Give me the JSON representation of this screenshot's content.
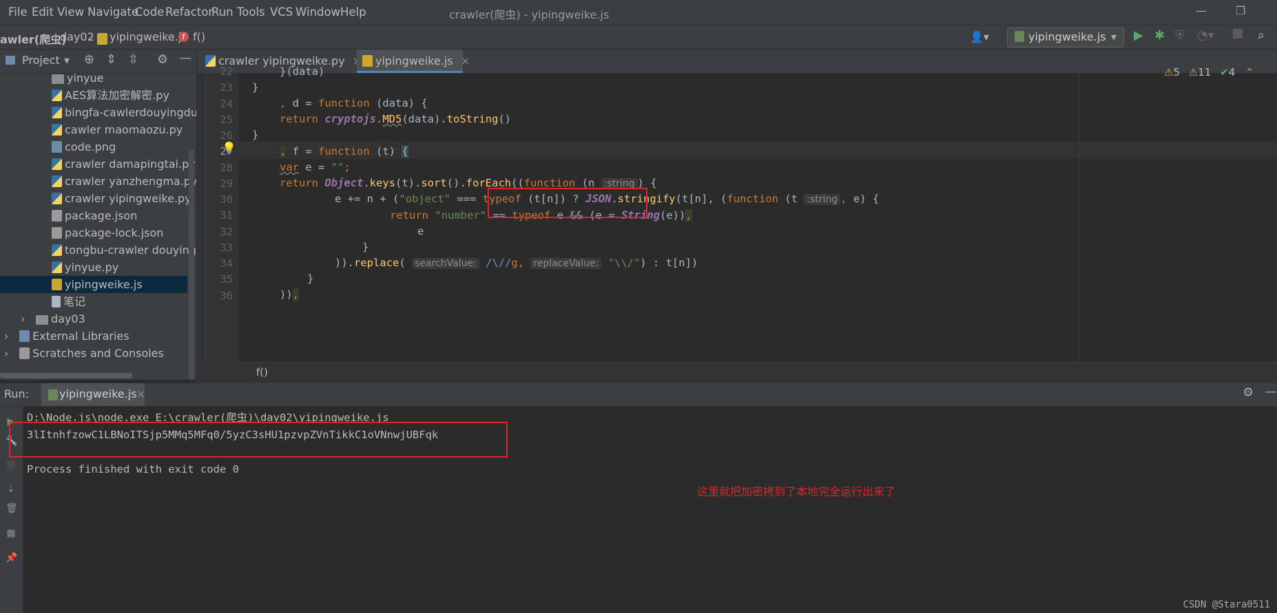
{
  "menu": [
    "File",
    "Edit",
    "View",
    "Navigate",
    "Code",
    "Refactor",
    "Run",
    "Tools",
    "VCS",
    "Window",
    "Help"
  ],
  "window_title": "crawler(爬虫) - yipingweike.js",
  "breadcrumb": {
    "root": "awler(爬虫)",
    "folder": "day02",
    "file": "yipingweike.js",
    "func": "f()"
  },
  "run_config": "yipingweike.js",
  "project_panel": {
    "title": "Project"
  },
  "tree": [
    {
      "label": "yinyue",
      "icon": "folder",
      "indent": 1
    },
    {
      "label": "AES算法加密解密.py",
      "icon": "py",
      "indent": 1
    },
    {
      "label": "bingfa-cawlerdouyingduan",
      "icon": "py",
      "indent": 1
    },
    {
      "label": "cawler maomaozu.py",
      "icon": "py",
      "indent": 1
    },
    {
      "label": "code.png",
      "icon": "png",
      "indent": 1
    },
    {
      "label": "crawler damapingtai.py",
      "icon": "py",
      "indent": 1
    },
    {
      "label": "crawler yanzhengma.py",
      "icon": "py",
      "indent": 1
    },
    {
      "label": "crawler yipingweike.py",
      "icon": "py",
      "indent": 1
    },
    {
      "label": "package.json",
      "icon": "json",
      "indent": 1
    },
    {
      "label": "package-lock.json",
      "icon": "json",
      "indent": 1
    },
    {
      "label": "tongbu-crawler douyingduan",
      "icon": "py",
      "indent": 1
    },
    {
      "label": "yinyue.py",
      "icon": "py",
      "indent": 1
    },
    {
      "label": "yipingweike.js",
      "icon": "js",
      "indent": 1,
      "selected": true
    },
    {
      "label": "笔记",
      "icon": "txt",
      "indent": 1
    },
    {
      "label": "day03",
      "icon": "folder",
      "indent": 0
    },
    {
      "label": "External Libraries",
      "icon": "lib",
      "indent": -1
    },
    {
      "label": "Scratches and Consoles",
      "icon": "scratch",
      "indent": -1
    }
  ],
  "tabs": [
    {
      "label": "crawler yipingweike.py",
      "active": false
    },
    {
      "label": "yipingweike.js",
      "active": true
    }
  ],
  "inspections": {
    "warnings": "5",
    "weak": "11",
    "ok": "4"
  },
  "line_numbers": [
    "22",
    "23",
    "24",
    "25",
    "26",
    "27",
    "28",
    "29",
    "30",
    "31",
    "32",
    "33",
    "34",
    "35",
    "36"
  ],
  "current_line": "27",
  "hints": {
    "n": ":string",
    "t": ":string",
    "search": "searchValue:",
    "replace": "replaceValue:"
  },
  "editor_crumb": "f()",
  "run": {
    "label": "Run:",
    "tab": "yipingweike.js",
    "command": "D:\\Node.js\\node.exe E:\\crawler(爬虫)\\day02\\yipingweike.js",
    "output": "3lItnhfzowC1LBNoITSjp5MMq5MFq0/5yzC3sHU1pzvpZVnTikkC1oVNnwjUBFqk",
    "exit": "Process finished with exit code 0",
    "note": "这里就把加密拷到了本地完全运行出来了"
  },
  "watermark": "CSDN @Stara0511"
}
